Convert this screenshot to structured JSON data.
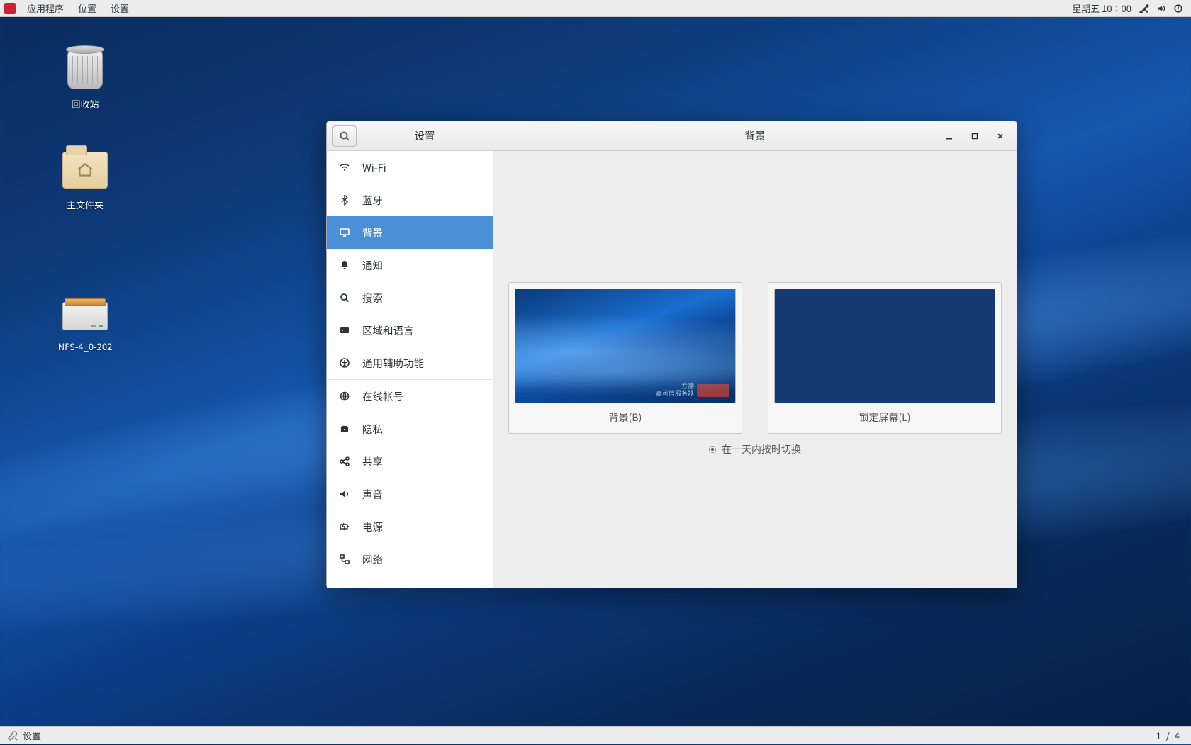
{
  "panel": {
    "menus": {
      "apps": "应用程序",
      "places": "位置",
      "settings": "设置"
    },
    "clock": "星期五 10∶00"
  },
  "desktop": {
    "trash": "回收站",
    "home": "主文件夹",
    "drive": "NFS-4_0-202"
  },
  "window": {
    "sidebar_title": "设置",
    "title": "背景",
    "sidebar": {
      "wifi": "Wi-Fi",
      "bluetooth": "蓝牙",
      "background": "背景",
      "notifications": "通知",
      "search": "搜索",
      "region": "区域和语言",
      "a11y": "通用辅助功能",
      "online": "在线帐号",
      "privacy": "隐私",
      "sharing": "共享",
      "sound": "声音",
      "power": "电源",
      "network": "网络"
    },
    "content": {
      "bg_label": "背景(B)",
      "lock_label": "锁定屏幕(L)",
      "hint": "在一天内按时切换"
    }
  },
  "taskbar": {
    "task1": "设置",
    "workspace": "1 / 4"
  }
}
